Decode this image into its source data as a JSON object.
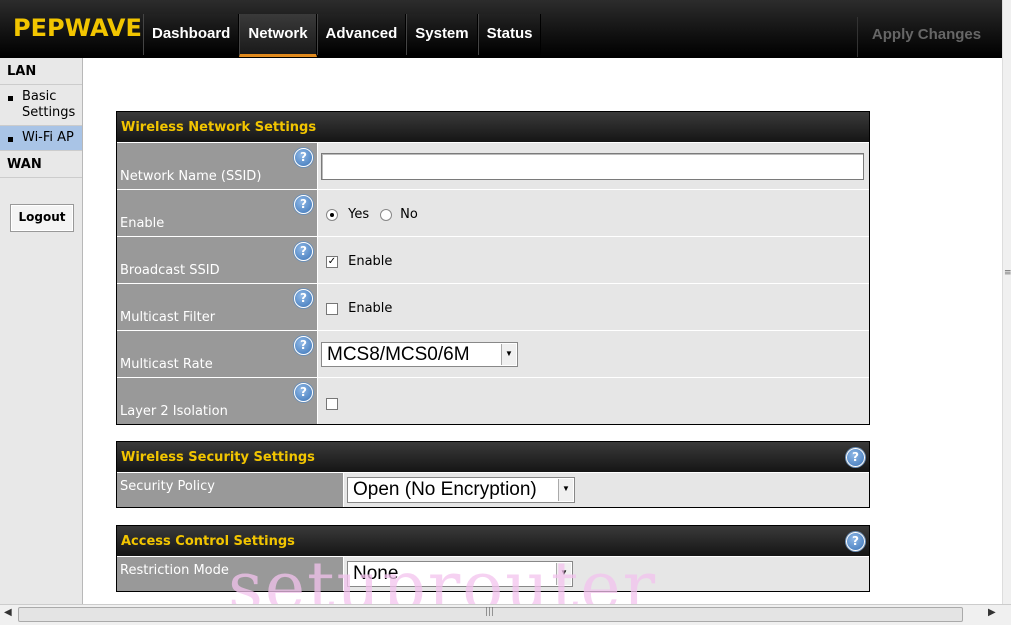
{
  "brand": {
    "logo": "PEPWAVE"
  },
  "nav": {
    "tabs": [
      "Dashboard",
      "Network",
      "Advanced",
      "System",
      "Status"
    ],
    "active": "Network",
    "apply_label": "Apply Changes"
  },
  "sidebar": {
    "lan_heading": "LAN",
    "items": [
      {
        "label": "Basic Settings",
        "selected": false
      },
      {
        "label": "Wi-Fi AP",
        "selected": true
      }
    ],
    "wan_heading": "WAN",
    "logout_label": "Logout"
  },
  "wireless_network": {
    "title": "Wireless Network Settings",
    "ssid_label": "Network Name (SSID)",
    "ssid_value": "",
    "enable_label": "Enable",
    "enable_yes": "Yes",
    "enable_no": "No",
    "broadcast_label": "Broadcast SSID",
    "broadcast_check_label": "Enable",
    "multicast_filter_label": "Multicast Filter",
    "multicast_filter_check_label": "Enable",
    "multicast_rate_label": "Multicast Rate",
    "multicast_rate_value": "MCS8/MCS0/6M",
    "layer2_label": "Layer 2 Isolation"
  },
  "wireless_security": {
    "title": "Wireless Security Settings",
    "policy_label": "Security Policy",
    "policy_value": "Open (No Encryption)"
  },
  "access_control": {
    "title": "Access Control Settings",
    "mode_label": "Restriction Mode",
    "mode_value": "None"
  },
  "watermark": "setuprouter",
  "icons": {
    "help": "help-question-icon",
    "scroll_left": "arrow-left-icon",
    "scroll_right": "arrow-right-icon",
    "dropdown": "chevron-down-icon"
  },
  "colors": {
    "brand_yellow": "#f2c500",
    "active_tab_underline": "#e08a1e",
    "row_label_bg": "#999999",
    "row_value_bg": "#e6e6e6",
    "sidebar_selected": "#a9c4e6"
  }
}
